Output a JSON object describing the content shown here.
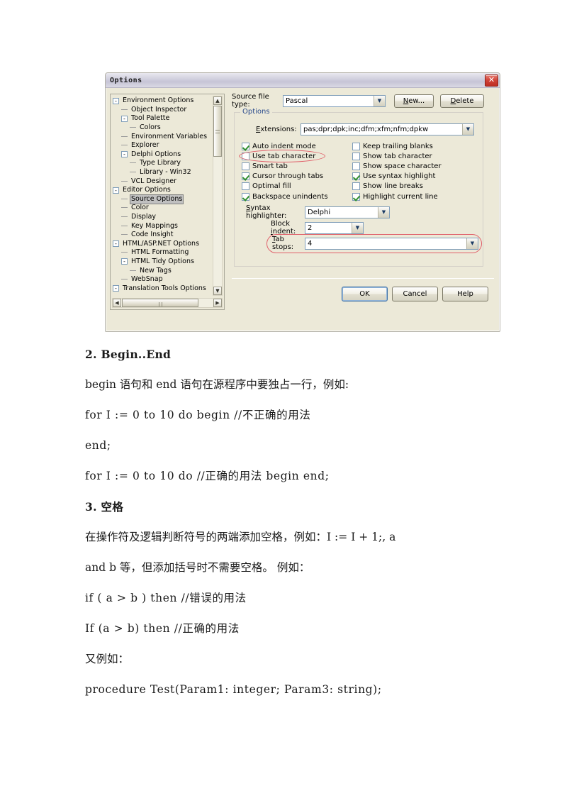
{
  "dialog": {
    "title": "Options",
    "close_icon": "close-icon",
    "tree": [
      {
        "label": "Environment Options",
        "indent": 0,
        "expander": "-",
        "selected": false
      },
      {
        "label": "Object Inspector",
        "indent": 1,
        "expander": "",
        "selected": false
      },
      {
        "label": "Tool Palette",
        "indent": 1,
        "expander": "-",
        "selected": false
      },
      {
        "label": "Colors",
        "indent": 2,
        "expander": "",
        "selected": false
      },
      {
        "label": "Environment Variables",
        "indent": 1,
        "expander": "",
        "selected": false
      },
      {
        "label": "Explorer",
        "indent": 1,
        "expander": "",
        "selected": false
      },
      {
        "label": "Delphi Options",
        "indent": 1,
        "expander": "-",
        "selected": false
      },
      {
        "label": "Type Library",
        "indent": 2,
        "expander": "",
        "selected": false
      },
      {
        "label": "Library - Win32",
        "indent": 2,
        "expander": "",
        "selected": false
      },
      {
        "label": "VCL Designer",
        "indent": 1,
        "expander": "",
        "selected": false
      },
      {
        "label": "Editor Options",
        "indent": 0,
        "expander": "-",
        "selected": false
      },
      {
        "label": "Source Options",
        "indent": 1,
        "expander": "",
        "selected": true
      },
      {
        "label": "Color",
        "indent": 1,
        "expander": "",
        "selected": false
      },
      {
        "label": "Display",
        "indent": 1,
        "expander": "",
        "selected": false
      },
      {
        "label": "Key Mappings",
        "indent": 1,
        "expander": "",
        "selected": false
      },
      {
        "label": "Code Insight",
        "indent": 1,
        "expander": "",
        "selected": false
      },
      {
        "label": "HTML/ASP.NET Options",
        "indent": 0,
        "expander": "-",
        "selected": false
      },
      {
        "label": "HTML Formatting",
        "indent": 1,
        "expander": "",
        "selected": false
      },
      {
        "label": "HTML Tidy Options",
        "indent": 1,
        "expander": "-",
        "selected": false
      },
      {
        "label": "New Tags",
        "indent": 2,
        "expander": "",
        "selected": false
      },
      {
        "label": "WebSnap",
        "indent": 1,
        "expander": "",
        "selected": false
      },
      {
        "label": "Translation Tools Options",
        "indent": 0,
        "expander": "-",
        "selected": false
      }
    ],
    "source_file_type": {
      "label": "Source file type:",
      "value": "Pascal"
    },
    "new_button": "New...",
    "delete_button": "Delete",
    "options_group": {
      "title": "Options",
      "extensions": {
        "label": "Extensions:",
        "value": "pas;dpr;dpk;inc;dfm;xfm;nfm;dpkw"
      },
      "checkboxes_left": [
        {
          "label": "Auto indent mode",
          "checked": true
        },
        {
          "label": "Use tab character",
          "checked": false
        },
        {
          "label": "Smart tab",
          "checked": false
        },
        {
          "label": "Cursor through tabs",
          "checked": true
        },
        {
          "label": "Optimal fill",
          "checked": false
        },
        {
          "label": "Backspace unindents",
          "checked": true
        }
      ],
      "checkboxes_right": [
        {
          "label": "Keep trailing blanks",
          "checked": false
        },
        {
          "label": "Show tab character",
          "checked": false
        },
        {
          "label": "Show space character",
          "checked": false
        },
        {
          "label": "Use syntax highlight",
          "checked": true
        },
        {
          "label": "Show line breaks",
          "checked": false
        },
        {
          "label": "Highlight current line",
          "checked": true
        }
      ],
      "syntax_highlighter": {
        "label": "Syntax highlighter:",
        "value": "Delphi"
      },
      "block_indent": {
        "label": "Block indent:",
        "value": "2"
      },
      "tab_stops": {
        "label": "Tab stops:",
        "value": "4"
      }
    },
    "footer": {
      "ok": "OK",
      "cancel": "Cancel",
      "help": "Help"
    },
    "annotation_color": "#e0606a"
  },
  "document": {
    "lines": [
      {
        "text": "2.   Begin..End",
        "style": "heading"
      },
      {
        "text": "begin 语句和 end 语句在源程序中要独占一行，例如:",
        "style": "body"
      },
      {
        "text": "for I := 0 to 10 do begin //不正确的用法",
        "style": "mono"
      },
      {
        "text": "end;",
        "style": "mono"
      },
      {
        "text": "for I := 0 to 10 do //正确的用法 begin end;",
        "style": "mono"
      },
      {
        "text": "3. 空格",
        "style": "heading"
      },
      {
        "text": "在操作符及逻辑判断符号的两端添加空格，例如：I := I + 1;, a",
        "style": "body"
      },
      {
        "text": "and b 等，但添加括号时不需要空格。 例如：",
        "style": "body"
      },
      {
        "text": "if ( a > b ) then //错误的用法",
        "style": "mono"
      },
      {
        "text": "If (a > b) then //正确的用法",
        "style": "mono"
      },
      {
        "text": "又例如：",
        "style": "body"
      },
      {
        "text": "procedure Test(Param1: integer; Param3: string);",
        "style": "mono"
      }
    ]
  }
}
